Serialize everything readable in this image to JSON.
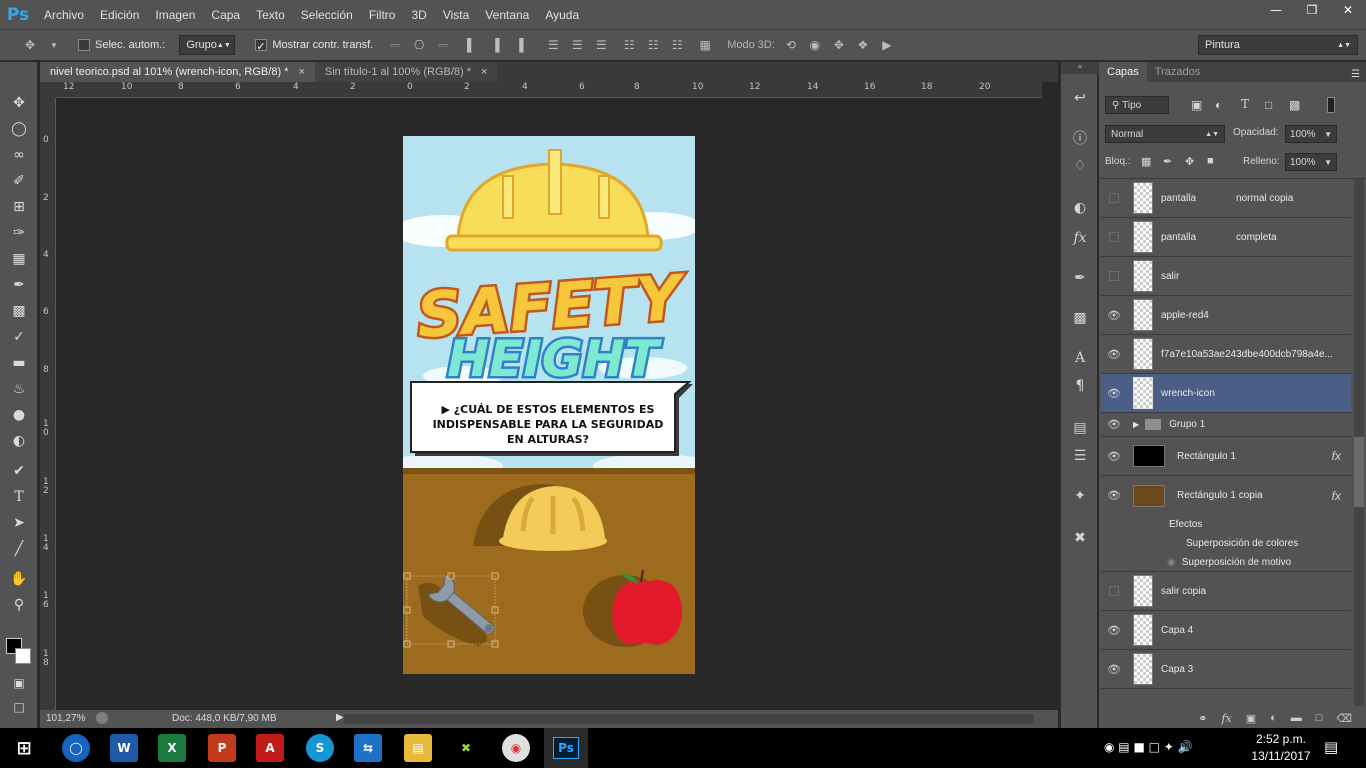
{
  "app": {
    "logo": "Ps",
    "menu": [
      "Archivo",
      "Edición",
      "Imagen",
      "Capa",
      "Texto",
      "Selección",
      "Filtro",
      "3D",
      "Vista",
      "Ventana",
      "Ayuda"
    ],
    "window_controls": [
      "minimize-icon",
      "restore-icon",
      "close-icon"
    ]
  },
  "options_bar": {
    "auto_select_label": "Selec. autom.:",
    "auto_select_value": "Grupo",
    "show_transform_label": "Mostrar contr. transf.",
    "mode3d_label": "Modo 3D:",
    "workspace": "Pintura"
  },
  "tabs": [
    {
      "label": "nivel teorico.psd al 101% (wrench-icon, RGB/8) *",
      "close": "×"
    },
    {
      "label": "Sin título-1 al 100% (RGB/8) *",
      "close": "×"
    }
  ],
  "ruler": {
    "top": [
      "12",
      "10",
      "8",
      "6",
      "4",
      "2",
      "0",
      "2",
      "4",
      "6",
      "8",
      "10",
      "12",
      "14",
      "16",
      "18",
      "20"
    ],
    "left": [
      "0",
      "2",
      "4",
      "6",
      "8",
      "1\n0",
      "1\n2",
      "1\n4",
      "1\n6",
      "1\n8"
    ]
  },
  "document": {
    "title_line1": "SAFETY",
    "title_line2": "HEIGHT",
    "question": "▶ ¿CUÁL DE ESTOS ELEMENTOS ES INDISPENSABLE PARA LA SEGURIDAD EN ALTURAS?",
    "colors": {
      "sky": "#b7e3f1",
      "ground": "#9c6b1d",
      "helmet": "#f7dd5a",
      "apple": "#e31a2b"
    }
  },
  "status": {
    "zoom": "101,27%",
    "doc": "Doc: 448,0 KB/7,90 MB"
  },
  "layers_panel": {
    "tabs": [
      "Capas",
      "Trazados"
    ],
    "filter": "Tipo",
    "blend_mode": "Normal",
    "opacity_label": "Opacidad:",
    "opacity_value": "100%",
    "lock_label": "Bloq.:",
    "fill_label": "Relleno:",
    "fill_value": "100%",
    "layers": [
      {
        "name": "pantalla",
        "extra": "normal copia",
        "visible": false
      },
      {
        "name": "pantalla",
        "extra": "completa",
        "visible": false
      },
      {
        "name": "salir",
        "extra": "",
        "visible": false
      },
      {
        "name": "apple-red4",
        "extra": "",
        "visible": true
      },
      {
        "name": "f7a7e10a53ae243dbe400dcb798a4e...",
        "extra": "",
        "visible": true
      },
      {
        "name": "wrench-icon",
        "extra": "",
        "visible": true,
        "selected": true
      },
      {
        "name": "Grupo 1",
        "extra": "",
        "visible": true,
        "group": true
      },
      {
        "name": "Rectángulo 1",
        "extra": "",
        "visible": true,
        "fx": "fx"
      },
      {
        "name": "Rectángulo 1 copia",
        "extra": "",
        "visible": true,
        "fx": "fx"
      },
      {
        "name": "salir  copia",
        "extra": "",
        "visible": false
      },
      {
        "name": "Capa 4",
        "extra": "",
        "visible": true
      },
      {
        "name": "Capa 3",
        "extra": "",
        "visible": true
      }
    ],
    "effects_label": "Efectos",
    "effects": [
      "Superposición de colores",
      "Superposición de motivo"
    ]
  },
  "taskbar": {
    "time": "2:52 p.m.",
    "date": "13/11/2017"
  }
}
